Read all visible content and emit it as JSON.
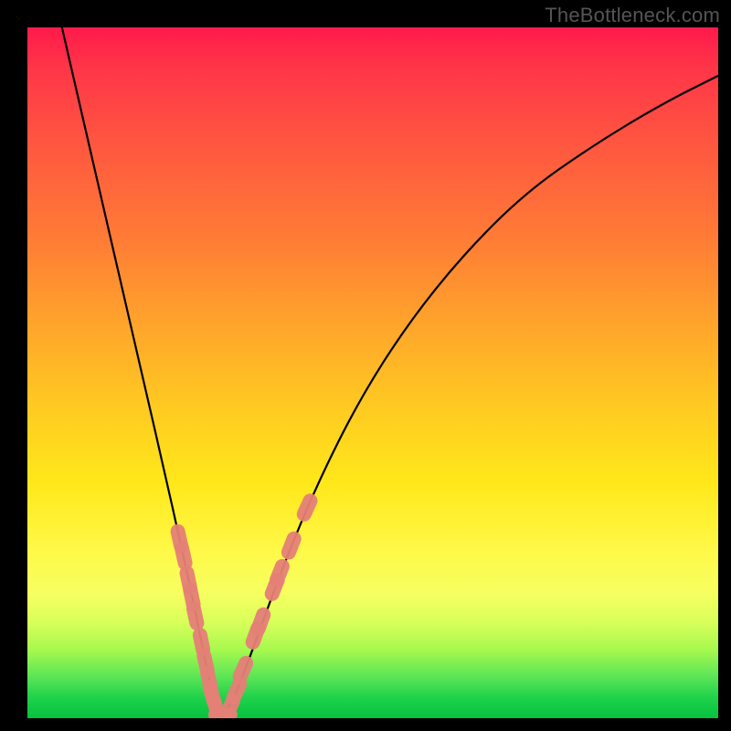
{
  "watermark": {
    "text": "TheBottleneck.com"
  },
  "chart_data": {
    "type": "line",
    "title": "",
    "xlabel": "",
    "ylabel": "",
    "xlim": [
      0,
      100
    ],
    "ylim": [
      0,
      100
    ],
    "series": [
      {
        "name": "bottleneck-curve",
        "x": [
          5,
          8,
          11,
          14,
          17,
          20,
          22,
          24,
          25,
          26,
          27,
          28,
          30,
          33,
          37,
          42,
          48,
          55,
          63,
          72,
          82,
          92,
          100
        ],
        "y": [
          100,
          87,
          74,
          61,
          48,
          35,
          26,
          17,
          12,
          7,
          3,
          0,
          3,
          11,
          22,
          34,
          46,
          57,
          67,
          76,
          83,
          89,
          93
        ]
      }
    ],
    "annotations": {
      "markers": [
        {
          "name": "left-marker-1",
          "x": 22.0,
          "y": 26.0
        },
        {
          "name": "left-marker-2",
          "x": 22.6,
          "y": 23.5
        },
        {
          "name": "left-marker-3",
          "x": 23.3,
          "y": 20.0
        },
        {
          "name": "left-marker-4",
          "x": 23.8,
          "y": 17.5
        },
        {
          "name": "left-marker-5",
          "x": 24.3,
          "y": 14.8
        },
        {
          "name": "left-marker-6",
          "x": 25.2,
          "y": 11.0
        },
        {
          "name": "left-marker-7",
          "x": 25.8,
          "y": 8.0
        },
        {
          "name": "left-marker-8",
          "x": 26.3,
          "y": 5.5
        },
        {
          "name": "left-marker-9",
          "x": 26.7,
          "y": 3.5
        },
        {
          "name": "bottom-marker-1",
          "x": 27.3,
          "y": 1.5
        },
        {
          "name": "bottom-marker-2",
          "x": 28.3,
          "y": 0.5
        },
        {
          "name": "bottom-marker-3",
          "x": 29.3,
          "y": 1.5
        },
        {
          "name": "right-marker-1",
          "x": 30.3,
          "y": 4.0
        },
        {
          "name": "right-marker-2",
          "x": 31.2,
          "y": 7.0
        },
        {
          "name": "right-marker-3",
          "x": 33.0,
          "y": 12.0
        },
        {
          "name": "right-marker-4",
          "x": 33.8,
          "y": 14.0
        },
        {
          "name": "right-marker-5",
          "x": 35.8,
          "y": 19.0
        },
        {
          "name": "right-marker-6",
          "x": 36.5,
          "y": 21.0
        },
        {
          "name": "right-marker-7",
          "x": 38.2,
          "y": 25.0
        },
        {
          "name": "right-marker-8",
          "x": 40.5,
          "y": 30.5
        }
      ]
    },
    "colors": {
      "curve": "#000000",
      "marker_fill": "#e58077",
      "marker_stroke": "#e58077",
      "background_top": "#ff1a4b",
      "background_bottom": "#06c13f"
    }
  }
}
